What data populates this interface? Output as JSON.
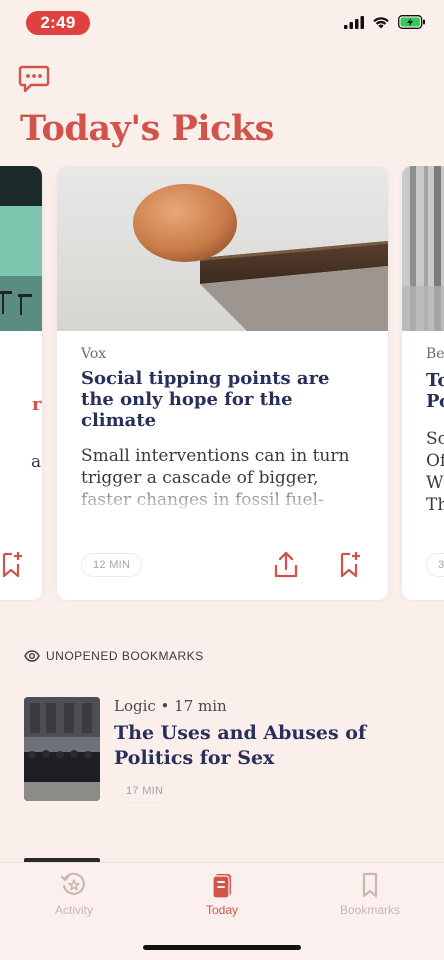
{
  "status": {
    "time": "2:49",
    "accent": "#e0413c"
  },
  "header": {
    "title": "Today's Picks",
    "comment_icon": "comment-dots-icon"
  },
  "carousel": {
    "left_card": {
      "title_fragment": "r",
      "desc_fragment": "a"
    },
    "main_card": {
      "source": "Vox",
      "title": "Social tipping points are the only hope for the climate",
      "description": "Small interventions can in turn trigger a cascade of bigger, faster changes in fossil fuel-based economies and cultures",
      "read_time": "12 MIN"
    },
    "right_card": {
      "source": "Be",
      "title_fragment": "To Po",
      "desc_fragment": "Sc Of W Th",
      "read_time": "3"
    }
  },
  "section": {
    "title": "UNOPENED BOOKMARKS"
  },
  "bookmark": {
    "meta": "Logic • 17 min",
    "title": "The Uses and Abuses of Politics for Sex",
    "read_time": "17 MIN"
  },
  "tabs": [
    {
      "label": "Activity",
      "icon": "activity-history-icon"
    },
    {
      "label": "Today",
      "icon": "today-card-icon"
    },
    {
      "label": "Bookmarks",
      "icon": "bookmark-icon"
    }
  ],
  "colors": {
    "brand": "#d1544b",
    "title_text": "#28305a",
    "background": "#fbefec"
  }
}
